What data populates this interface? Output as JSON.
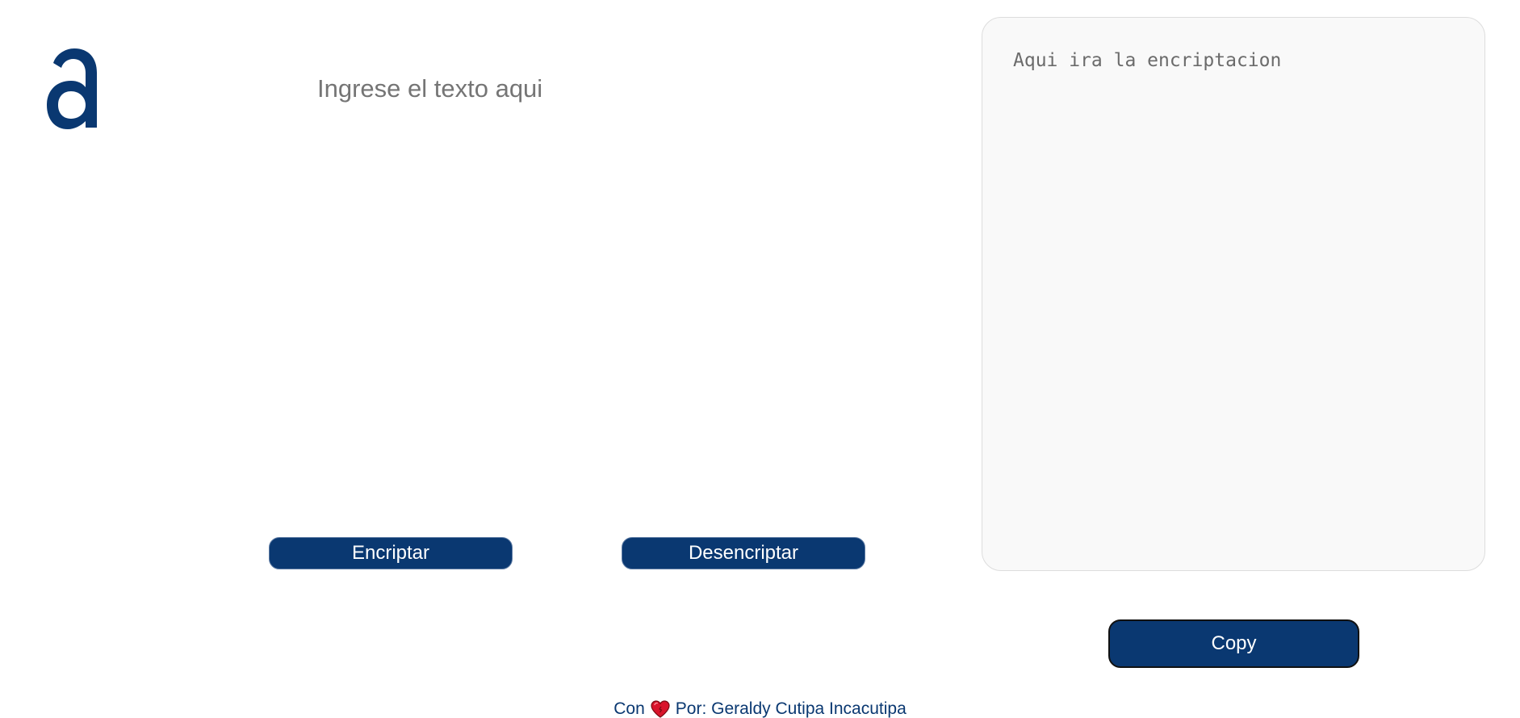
{
  "logo": {
    "icon": "alura-a-logo-icon",
    "color": "#0a3871"
  },
  "input": {
    "placeholder": "Ingrese el texto aqui",
    "value": ""
  },
  "actions": {
    "encrypt_label": "Encriptar",
    "decrypt_label": "Desencriptar"
  },
  "output": {
    "placeholder": "Aqui ira la encriptacion",
    "value": ""
  },
  "copy": {
    "label": "Copy"
  },
  "footer": {
    "prefix": "Con",
    "icon": "heart-icon",
    "suffix": "Por: Geraldy Cutipa Incacutipa"
  },
  "colors": {
    "brand": "#0a3871",
    "panel_bg": "#f9f9f9",
    "panel_border": "#dddddd"
  }
}
